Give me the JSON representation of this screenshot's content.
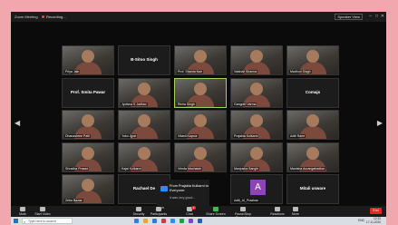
{
  "window": {
    "title": "Zoom Meeting",
    "recording": "Recording..."
  },
  "view_button": "Speaker View",
  "tiles": [
    {
      "kind": "video",
      "label": "Priya Jain",
      "row": 0,
      "col": 0
    },
    {
      "kind": "name",
      "name": "B-Sitoo Singh",
      "row": 0,
      "col": 1
    },
    {
      "kind": "video",
      "label": "Prof. Sharda Nair",
      "row": 0,
      "col": 2
    },
    {
      "kind": "video",
      "label": "Vaishali Sharma",
      "row": 0,
      "col": 3
    },
    {
      "kind": "video",
      "label": "Madhuri Singh",
      "row": 0,
      "col": 4
    },
    {
      "kind": "name",
      "name": "Prof. Smita Pawar",
      "row": 1,
      "col": 0
    },
    {
      "kind": "video",
      "label": "Jyotsna S Jadhav",
      "row": 1,
      "col": 1
    },
    {
      "kind": "video",
      "label": "Richa Singh",
      "row": 1,
      "col": 2,
      "active": true
    },
    {
      "kind": "video",
      "label": "Gangotri Varma",
      "row": 1,
      "col": 3
    },
    {
      "kind": "name",
      "name": "Comajs",
      "row": 1,
      "col": 4
    },
    {
      "kind": "video",
      "label": "Dhanashree Patil",
      "row": 2,
      "col": 0
    },
    {
      "kind": "video",
      "label": "Yoko Jjpar",
      "row": 2,
      "col": 1
    },
    {
      "kind": "video",
      "label": "Vitasti Kapoor",
      "row": 2,
      "col": 2
    },
    {
      "kind": "video",
      "label": "Prajakta Kulkarni",
      "row": 2,
      "col": 3
    },
    {
      "kind": "video",
      "label": "Aditi Rane",
      "row": 2,
      "col": 4
    },
    {
      "kind": "video",
      "label": "Shradha Prasad",
      "row": 3,
      "col": 0
    },
    {
      "kind": "video",
      "label": "Kajal Kulkarni",
      "row": 3,
      "col": 1
    },
    {
      "kind": "video",
      "label": "Vrinda Machaiah",
      "row": 3,
      "col": 2
    },
    {
      "kind": "video",
      "label": "Manjusha Sanghi",
      "row": 3,
      "col": 3
    },
    {
      "kind": "video",
      "label": "Manisha Aurangabadkar",
      "row": 3,
      "col": 4
    },
    {
      "kind": "video",
      "label": "Zeba Bazaz",
      "row": 4,
      "col": 0
    },
    {
      "kind": "name",
      "name": "Rachael De",
      "row": 4,
      "col": 1
    },
    {
      "kind": "avatar",
      "letter": "A",
      "label": "Aditi_Al_Pradhan",
      "row": 4,
      "col": 3
    },
    {
      "kind": "name",
      "name": "Mitali usware",
      "row": 4,
      "col": 4
    }
  ],
  "chat": {
    "from": "From Prajakta Kulkarni to Everyone:",
    "message": "it was very good..."
  },
  "toolbar": {
    "buttons": [
      {
        "label": "Mute",
        "icon": "microphone-icon"
      },
      {
        "label": "Start Video",
        "icon": "video-camera-icon"
      },
      {
        "label": "Security",
        "icon": "shield-icon"
      },
      {
        "label": "Participants",
        "icon": "participants-icon",
        "count": "25"
      },
      {
        "label": "Chat",
        "icon": "chat-icon",
        "badge": "1"
      },
      {
        "label": "Share Screen",
        "icon": "share-screen-icon",
        "green": true
      },
      {
        "label": "Pause/Stop Recording",
        "icon": "record-icon"
      },
      {
        "label": "Reactions",
        "icon": "reactions-icon"
      },
      {
        "label": "More",
        "icon": "more-icon"
      }
    ],
    "end_label": "End"
  },
  "taskbar": {
    "search_placeholder": "Type here to search",
    "language": "ENG",
    "time": "12:32",
    "date": "17-11-2020"
  },
  "colors": {
    "page_bg": "#f2a7ae",
    "screen_bg": "#0b0b0b",
    "active_border": "#9ed45a",
    "end_button": "#e02828",
    "avatar": "#8e44b5"
  }
}
